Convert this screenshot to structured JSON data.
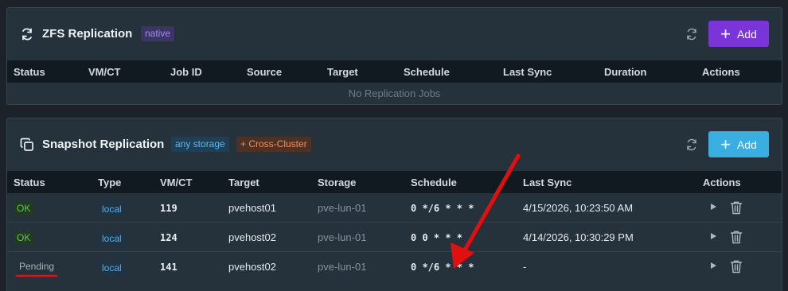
{
  "zfs": {
    "title": "ZFS Replication",
    "badge": "native",
    "add_label": "Add",
    "icon": "refresh-cycle-icon",
    "columns": [
      "Status",
      "VM/CT",
      "Job ID",
      "Source",
      "Target",
      "Schedule",
      "Last Sync",
      "Duration",
      "Actions"
    ],
    "empty_message": "No Replication Jobs"
  },
  "snapshot": {
    "title": "Snapshot Replication",
    "badge_storage": "any storage",
    "badge_cross": "+ Cross-Cluster",
    "add_label": "Add",
    "icon": "copy-icon",
    "columns": [
      "Status",
      "Type",
      "VM/CT",
      "Target",
      "Storage",
      "Schedule",
      "Last Sync",
      "Actions"
    ],
    "rows": [
      {
        "status": "OK",
        "type": "local",
        "vmct": "119",
        "target": "pvehost01",
        "storage": "pve-lun-01",
        "schedule": "0 */6 * * *",
        "last_sync": "4/15/2026, 10:23:50 AM"
      },
      {
        "status": "OK",
        "type": "local",
        "vmct": "124",
        "target": "pvehost02",
        "storage": "pve-lun-01",
        "schedule": "0 0 * * *",
        "last_sync": "4/14/2026, 10:30:29 PM"
      },
      {
        "status": "Pending",
        "type": "local",
        "vmct": "141",
        "target": "pvehost02",
        "storage": "pve-lun-01",
        "schedule": "0 */6 * * *",
        "last_sync": "-"
      }
    ]
  },
  "colors": {
    "purple_button": "#7a35d8",
    "blue_button": "#3aaee0",
    "ok_green": "#5fc65a",
    "annotation_red": "#e01010"
  }
}
